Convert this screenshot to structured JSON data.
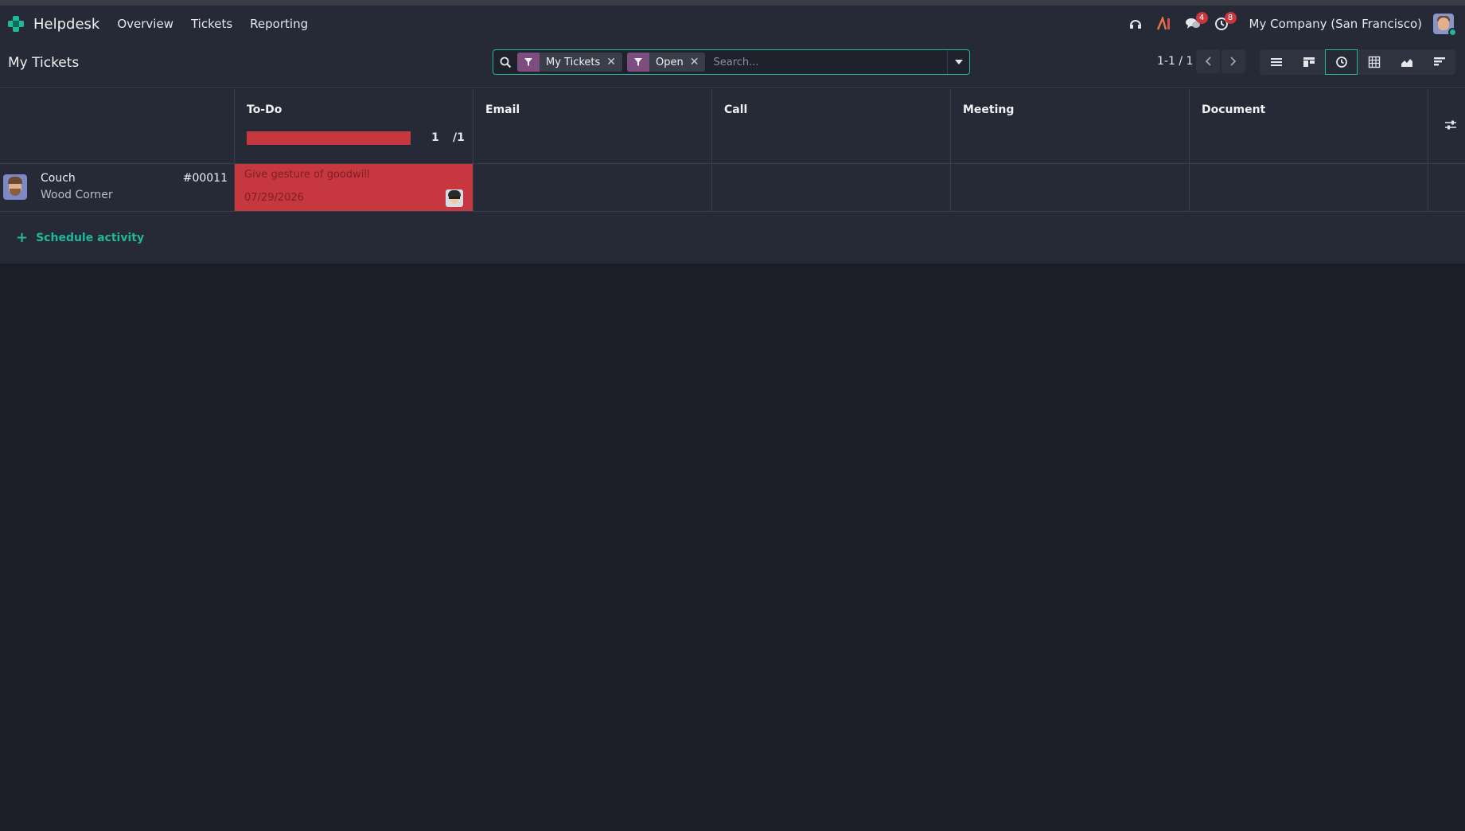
{
  "navbar": {
    "app_name": "Helpdesk",
    "menu": [
      "Overview",
      "Tickets",
      "Reporting"
    ],
    "messages_badge": "4",
    "activities_badge": "8",
    "company": "My Company (San Francisco)"
  },
  "control_panel": {
    "title": "My Tickets",
    "facets": [
      "My Tickets",
      "Open"
    ],
    "search_placeholder": "Search...",
    "pager": "1-1 / 1",
    "views": [
      "list-icon",
      "kanban-icon",
      "activity-icon",
      "pivot-icon",
      "graph-icon",
      "cohort-icon"
    ],
    "active_view": "activity-icon"
  },
  "activity_view": {
    "columns": [
      {
        "title": "To-Do",
        "done": "1",
        "total": "/1",
        "progress": 1.0
      },
      {
        "title": "Email"
      },
      {
        "title": "Call"
      },
      {
        "title": "Meeting"
      },
      {
        "title": "Document"
      }
    ],
    "rows": [
      {
        "name": "Couch",
        "partner": "Wood Corner",
        "ref": "#00011",
        "todo": {
          "summary": "Give gesture of goodwill",
          "date": "07/29/2026",
          "state": "overdue"
        }
      }
    ],
    "schedule_label": "Schedule activity"
  },
  "colors": {
    "accent": "#21b799",
    "overdue": "#c6373f",
    "facet": "#7c4e7f",
    "background": "#1b1e27",
    "panel": "#262a36"
  }
}
